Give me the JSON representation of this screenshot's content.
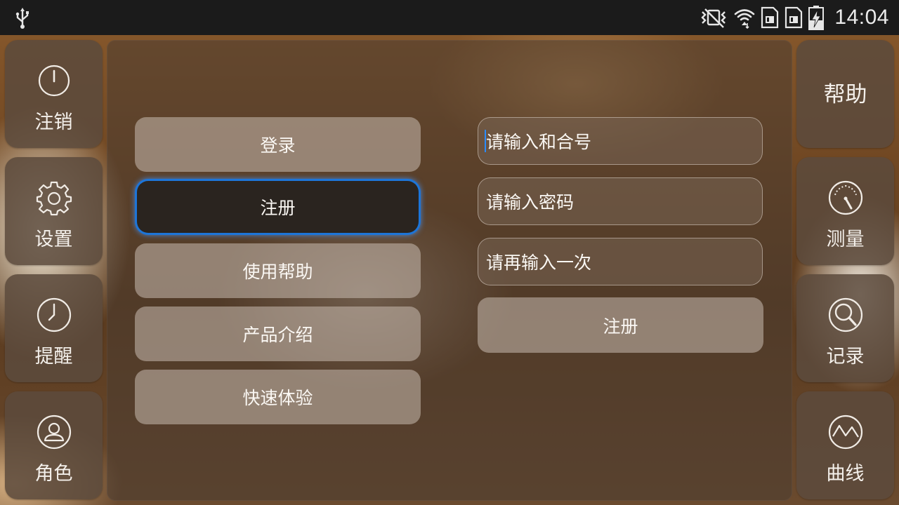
{
  "status_bar": {
    "time": "14:04",
    "icons": [
      "usb-icon",
      "vibrate-mute-icon",
      "wifi-icon",
      "sim-card-1-icon",
      "sim-card-2-icon",
      "battery-charging-icon"
    ]
  },
  "left_nav": [
    {
      "label": "注销",
      "icon": "power-icon"
    },
    {
      "label": "设置",
      "icon": "gear-icon"
    },
    {
      "label": "提醒",
      "icon": "clock-icon"
    },
    {
      "label": "角色",
      "icon": "user-icon"
    }
  ],
  "right_nav": {
    "help": {
      "label": "帮助"
    },
    "items": [
      {
        "label": "测量",
        "icon": "gauge-icon"
      },
      {
        "label": "记录",
        "icon": "magnifier-icon"
      },
      {
        "label": "曲线",
        "icon": "curve-chart-icon"
      }
    ]
  },
  "menu": [
    {
      "label": "登录",
      "selected": false
    },
    {
      "label": "注册",
      "selected": true
    },
    {
      "label": "使用帮助",
      "selected": false
    },
    {
      "label": "产品介绍",
      "selected": false
    },
    {
      "label": "快速体验",
      "selected": false
    }
  ],
  "form": {
    "account_placeholder": "请输入和合号",
    "password_placeholder": "请输入密码",
    "confirm_placeholder": "请再输入一次",
    "submit_label": "注册"
  },
  "colors": {
    "focus_ring": "#1d75d8",
    "status_bar_bg": "#1b1b1b"
  }
}
